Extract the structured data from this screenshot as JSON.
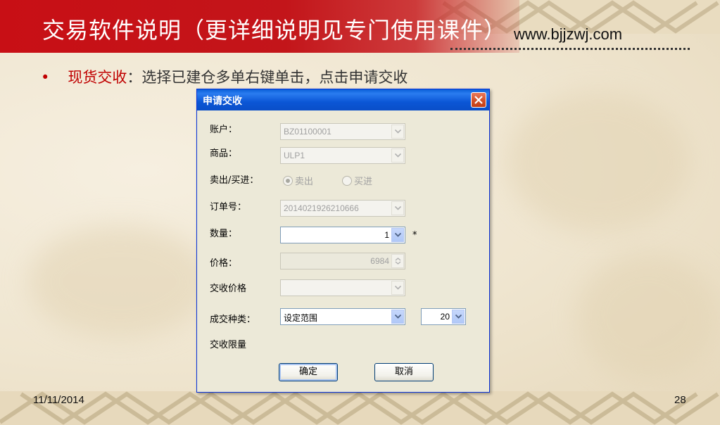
{
  "slide": {
    "title": "交易软件说明（更详细说明见专门使用课件）",
    "website": "www.bjjzwj.com",
    "bullet_dot": "•",
    "bullet_strong": "现货交收",
    "bullet_rest": "：选择已建仓多单右键单击，点击申请交收",
    "footer_date": "11/11/2014",
    "footer_page": "28"
  },
  "colors": {
    "title_red": "#c80f15",
    "bullet_red": "#c00000",
    "xp_blue": "#0a5fd8"
  },
  "dialog": {
    "title": "申请交收",
    "account_label": "账户：",
    "account_value": "BZ01100001",
    "product_label": "商品：",
    "product_value": "ULP1",
    "direction_label": "卖出/买进：",
    "sell_label": "卖出",
    "buy_label": "买进",
    "selected_direction": "卖出",
    "order_label": "订单号：",
    "order_value": "2014021926210666",
    "quantity_label": "数量：",
    "quantity_value": "1",
    "required_mark": "*",
    "price_label": "价格：",
    "price_value": "6984",
    "delivery_price_label": "交收价格",
    "delivery_price_value": "",
    "deal_type_label": "成交种类：",
    "deal_type_value": "设定范围",
    "range_value": "20",
    "delivery_limit_label": "交收限量",
    "ok_label": "确定",
    "cancel_label": "取消"
  }
}
